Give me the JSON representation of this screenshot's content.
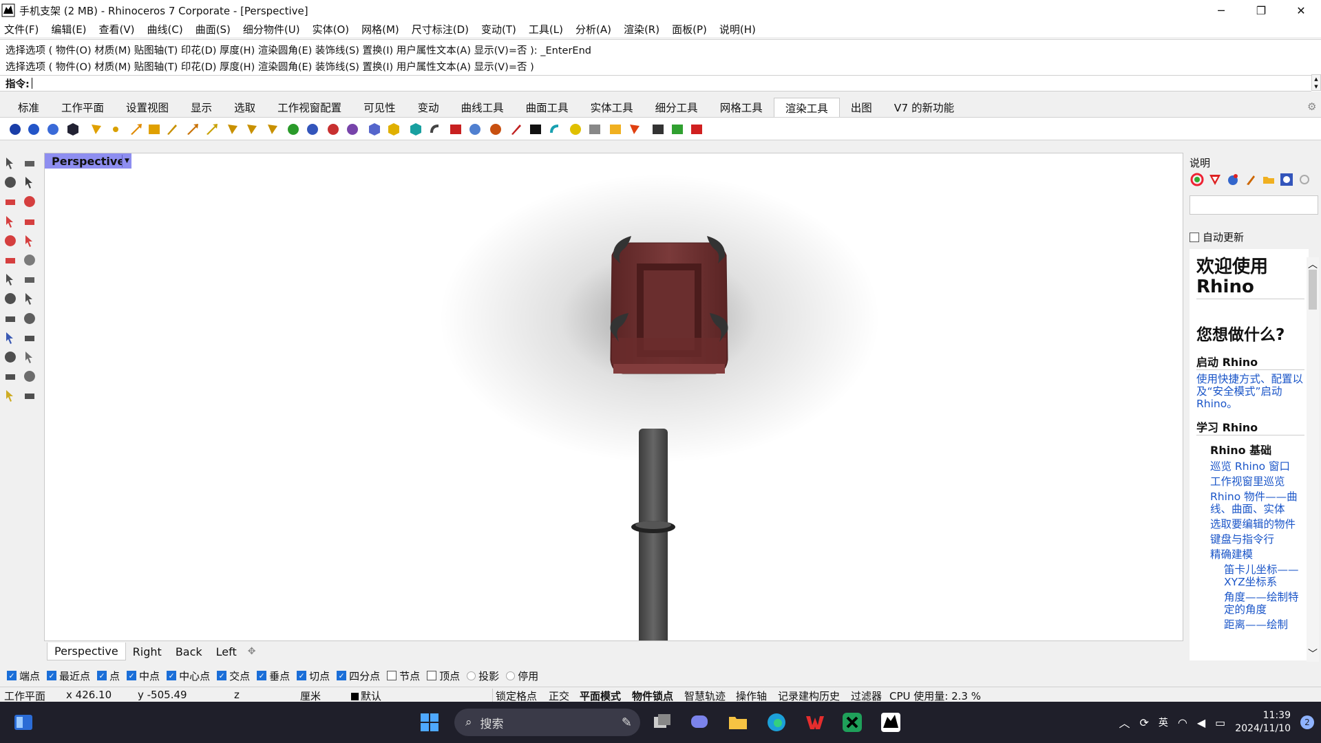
{
  "titlebar": {
    "title": "手机支架 (2 MB) - Rhinoceros 7 Corporate - [Perspective]",
    "minimize": "─",
    "restore": "❐",
    "close": "✕"
  },
  "menu": [
    "文件(F)",
    "编辑(E)",
    "查看(V)",
    "曲线(C)",
    "曲面(S)",
    "细分物件(U)",
    "实体(O)",
    "网格(M)",
    "尺寸标注(D)",
    "变动(T)",
    "工具(L)",
    "分析(A)",
    "渲染(R)",
    "面板(P)",
    "说明(H)"
  ],
  "command": {
    "history_line_1": "选择选项 ( 物件(O)  材质(M)  贴图轴(T)  印花(D)  厚度(H)  渲染圆角(E)  装饰线(S)  置换(I)  用户属性文本(A)  显示(V)=否 ): _EnterEnd",
    "history_line_2": "选择选项 ( 物件(O)  材质(M)  贴图轴(T)  印花(D)  厚度(H)  渲染圆角(E)  装饰线(S)  置换(I)  用户属性文本(A)  显示(V)=否 )",
    "prompt_label": "指令:",
    "value": ""
  },
  "toolbar_tabs": [
    {
      "label": "标准",
      "active": false
    },
    {
      "label": "工作平面",
      "active": false
    },
    {
      "label": "设置视图",
      "active": false
    },
    {
      "label": "显示",
      "active": false
    },
    {
      "label": "选取",
      "active": false
    },
    {
      "label": "工作视窗配置",
      "active": false
    },
    {
      "label": "可见性",
      "active": false
    },
    {
      "label": "变动",
      "active": false
    },
    {
      "label": "曲线工具",
      "active": false
    },
    {
      "label": "曲面工具",
      "active": false
    },
    {
      "label": "实体工具",
      "active": false
    },
    {
      "label": "细分工具",
      "active": false
    },
    {
      "label": "网格工具",
      "active": false
    },
    {
      "label": "渲染工具",
      "active": true
    },
    {
      "label": "出图",
      "active": false
    },
    {
      "label": "V7 的新功能",
      "active": false
    }
  ],
  "viewport": {
    "title": "Perspective",
    "tabs": [
      {
        "label": "Perspective",
        "active": true
      },
      {
        "label": "Right",
        "active": false
      },
      {
        "label": "Back",
        "active": false
      },
      {
        "label": "Left",
        "active": false
      }
    ],
    "add_tab": "✥"
  },
  "right_panel": {
    "title": "说明",
    "auto_update": "自动更新",
    "doc": {
      "welcome": "欢迎使用 Rhino",
      "question": "您想做什么?",
      "start_heading": "启动 Rhino",
      "start_link": "使用快捷方式、配置以及“安全模式”启动 Rhino。",
      "learn_heading": "学习 Rhino",
      "basics_heading": "Rhino 基础",
      "links": [
        {
          "text": "巡览 Rhino 窗口",
          "level": 2
        },
        {
          "text": "工作视窗里巡览",
          "level": 2
        },
        {
          "text": "Rhino 物件——曲线、曲面、实体",
          "level": 2
        },
        {
          "text": "选取要编辑的物件",
          "level": 2
        },
        {
          "text": "键盘与指令行",
          "level": 2
        },
        {
          "text": "精确建模",
          "level": 2
        },
        {
          "text": "笛卡儿坐标——XYZ坐标系",
          "level": 3
        },
        {
          "text": "角度——绘制特定的角度",
          "level": 3
        },
        {
          "text": "距离——绘制",
          "level": 3
        }
      ]
    }
  },
  "osnaps": [
    {
      "label": "端点",
      "checked": true,
      "kind": "box"
    },
    {
      "label": "最近点",
      "checked": true,
      "kind": "box"
    },
    {
      "label": "点",
      "checked": true,
      "kind": "box"
    },
    {
      "label": "中点",
      "checked": true,
      "kind": "box"
    },
    {
      "label": "中心点",
      "checked": true,
      "kind": "box"
    },
    {
      "label": "交点",
      "checked": true,
      "kind": "box"
    },
    {
      "label": "垂点",
      "checked": true,
      "kind": "box"
    },
    {
      "label": "切点",
      "checked": true,
      "kind": "box"
    },
    {
      "label": "四分点",
      "checked": true,
      "kind": "box"
    },
    {
      "label": "节点",
      "checked": false,
      "kind": "box"
    },
    {
      "label": "顶点",
      "checked": false,
      "kind": "box"
    },
    {
      "label": "投影",
      "checked": false,
      "kind": "radio"
    },
    {
      "label": "停用",
      "checked": false,
      "kind": "radio"
    }
  ],
  "status": {
    "cplane": "工作平面",
    "x": "x 426.10",
    "y": "y -505.49",
    "z": "z",
    "units": "厘米",
    "layer": "默认",
    "lock_grid": "锁定格点",
    "ortho": "正交",
    "planar": "平面模式",
    "osnap": "物件锁点",
    "smarttrack": "智慧轨迹",
    "gumball": "操作轴",
    "history": "记录建构历史",
    "filter": "过滤器",
    "cpu": "CPU 使用量: 2.3 %"
  },
  "taskbar": {
    "search_placeholder": "搜索",
    "ime": "英",
    "time": "11:39",
    "date": "2024/11/10",
    "notifications": "2"
  },
  "colors": {
    "viewport_title_bg": "#8e8ef0",
    "link": "#1a55c8",
    "checkbox_on": "#1a6ed8",
    "model_body": "#6b2f2f",
    "model_stem": "#4e4e4e",
    "taskbar_bg": "#1f1f2a"
  }
}
